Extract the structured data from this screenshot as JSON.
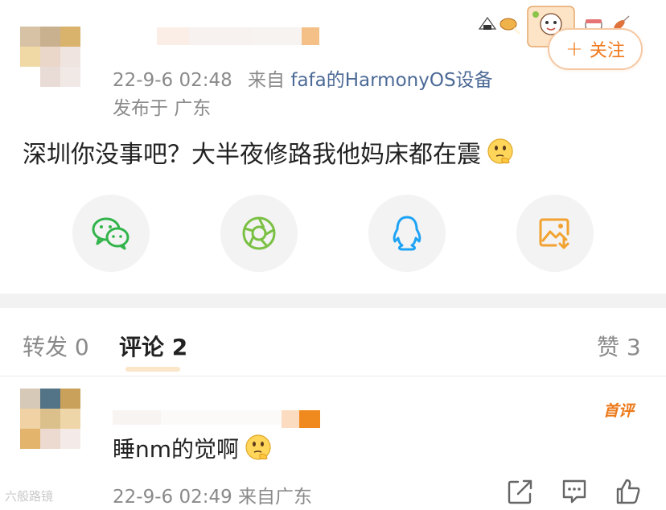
{
  "post": {
    "timestamp": "22-9-6 02:48",
    "source_prefix": "来自",
    "device": "fafa的HarmonyOS设备",
    "location": "发布于 广东",
    "text": "深圳你没事吧？大半夜修路我他妈床都在震",
    "follow_label": "关注",
    "follow_icon": "plus-icon"
  },
  "share": [
    {
      "name": "wechat-share",
      "icon": "wechat-icon",
      "color": "#33b44b"
    },
    {
      "name": "moments-share",
      "icon": "moments-aperture-icon",
      "color": "#7ac043"
    },
    {
      "name": "qq-share",
      "icon": "qq-penguin-icon",
      "color": "#1da3f5"
    },
    {
      "name": "save-image",
      "icon": "image-download-icon",
      "color": "#f2a230"
    }
  ],
  "tabs": {
    "repost": "转发 0",
    "comments": "评论 2",
    "likes": "赞 3"
  },
  "comment": {
    "text": "睡nm的觉啊",
    "badge": "首评",
    "meta": "22-9-6 02:49 来自广东"
  },
  "watermark": "六般路镜",
  "colors": {
    "accent": "#f07a1e",
    "link": "#4c6a96",
    "meta": "#8a8a8a"
  }
}
